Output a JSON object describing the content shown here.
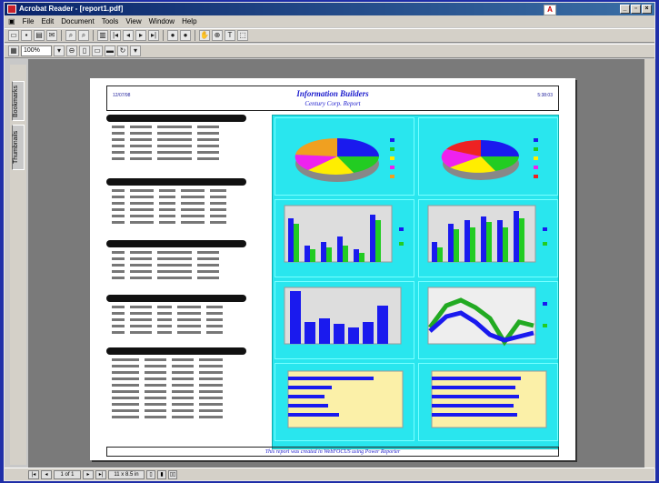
{
  "window": {
    "title": "Acrobat Reader - [report1.pdf]",
    "controls": [
      "_",
      "▫",
      "×"
    ]
  },
  "menu": [
    "File",
    "Edit",
    "Document",
    "Tools",
    "View",
    "Window",
    "Help"
  ],
  "toolbar": {
    "zoom_value": "100%"
  },
  "nav_tabs": [
    "Bookmarks",
    "Thumbnails"
  ],
  "report": {
    "header_left": "12/07/98",
    "header_right": "5:38:03",
    "title": "Information Builders",
    "subtitle": "Century Corp. Report",
    "footer": "This report was created in WebFOCUS using Power Reporter"
  },
  "statusbar": {
    "page_indicator": "1 of 1",
    "page_size": "11 x 8.5 in"
  },
  "colors": {
    "chart_background": "#29e6ee",
    "series_blue": "#1a1aee",
    "series_green": "#22cc22"
  }
}
